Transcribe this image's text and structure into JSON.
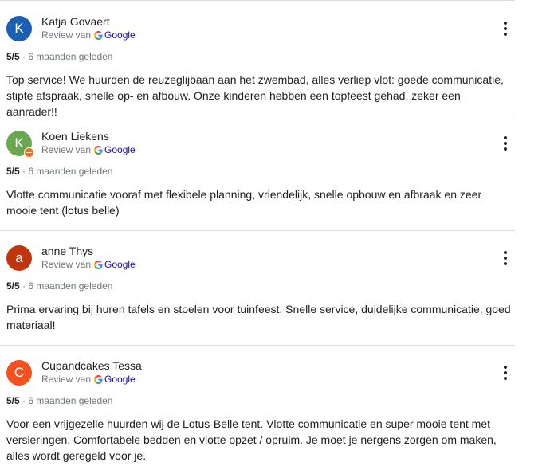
{
  "reviews": [
    {
      "initial": "K",
      "avatar_color": "#1a5fb4",
      "badge": false,
      "name": "Katja Govaert",
      "source_prefix": "Review van",
      "source_name": "Google",
      "rating": "5/5",
      "separator": "·",
      "time": "6 maanden geleden",
      "text": "Top service! We huurden de reuzeglijbaan aan het zwembad, alles verliep vlot: goede communicatie, stipte afspraak, snelle op- en afbouw. Onze kinderen hebben een topfeest gehad, zeker een aanrader!!"
    },
    {
      "initial": "K",
      "avatar_color": "#6aa84f",
      "badge": true,
      "name": "Koen Liekens",
      "source_prefix": "Review van",
      "source_name": "Google",
      "rating": "5/5",
      "separator": "·",
      "time": "6 maanden geleden",
      "text": "Vlotte communicatie vooraf met flexibele planning, vriendelijk, snelle opbouw en afbraak en zeer mooie tent (lotus belle)"
    },
    {
      "initial": "a",
      "avatar_color": "#bf360c",
      "badge": false,
      "name": "anne Thys",
      "source_prefix": "Review van",
      "source_name": "Google",
      "rating": "5/5",
      "separator": "·",
      "time": "6 maanden geleden",
      "text": "Prima ervaring bij huren tafels en stoelen voor tuinfeest. Snelle service, duidelijke communicatie, goed materiaal!"
    },
    {
      "initial": "C",
      "avatar_color": "#f4511e",
      "badge": false,
      "name": "Cupandcakes Tessa",
      "source_prefix": "Review van",
      "source_name": "Google",
      "rating": "5/5",
      "separator": "·",
      "time": "6 maanden geleden",
      "text": "Voor een vrijgezelle huurden wij de Lotus-Belle tent. Vlotte communicatie en super mooie tent met versieringen. Comfortabele bedden en vlotte opzet / opruim. Je moet je nergens zorgen om maken, alles wordt geregeld voor je."
    }
  ]
}
